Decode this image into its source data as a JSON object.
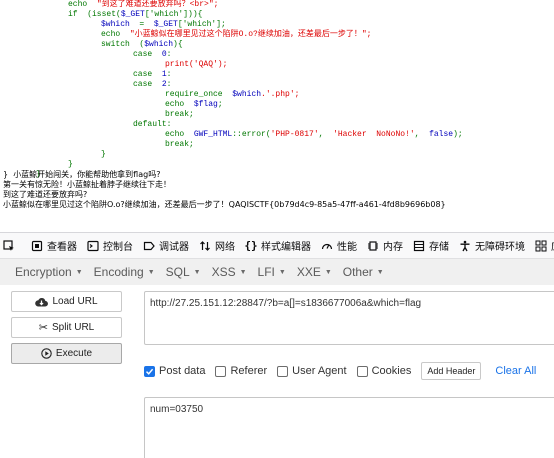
{
  "page_output": {
    "code_lines": [
      [
        {
          "t": "echo  ",
          "c": "kw"
        },
        {
          "t": "\"到这了难道还要放弃吗？<br>\";",
          "c": "str"
        }
      ],
      [
        {
          "t": "if  (isset(",
          "c": "kw"
        },
        {
          "t": "$_GET",
          "c": "var"
        },
        {
          "t": "['which'])){",
          "c": "kw"
        }
      ],
      [
        {
          "t": "$which  ",
          "c": "var"
        },
        {
          "t": "=  ",
          "c": "kw"
        },
        {
          "t": "$_GET",
          "c": "var"
        },
        {
          "t": "['which'];",
          "c": "kw"
        }
      ],
      [
        {
          "t": "echo  ",
          "c": "kw"
        },
        {
          "t": "\"小蓝鲸似在哪里见过这个陷阱O.o?继续加油，还差最后一步了！\";",
          "c": "str"
        }
      ],
      [
        {
          "t": "switch  (",
          "c": "kw"
        },
        {
          "t": "$which",
          "c": "var"
        },
        {
          "t": "){",
          "c": "kw"
        }
      ],
      [
        {
          "t": "case  ",
          "c": "kw"
        },
        {
          "t": "0",
          "c": "var"
        },
        {
          "t": ":",
          "c": "kw"
        }
      ],
      [
        {
          "t": "print('QAQ');",
          "c": "str"
        }
      ],
      [
        {
          "t": "case  ",
          "c": "kw"
        },
        {
          "t": "1",
          "c": "var"
        },
        {
          "t": ":",
          "c": "kw"
        }
      ],
      [
        {
          "t": "case  ",
          "c": "kw"
        },
        {
          "t": "2",
          "c": "var"
        },
        {
          "t": ":",
          "c": "kw"
        }
      ],
      [
        {
          "t": "require_once  ",
          "c": "kw"
        },
        {
          "t": "$which",
          "c": "var"
        },
        {
          "t": ".'.php';",
          "c": "str"
        }
      ],
      [
        {
          "t": "echo  ",
          "c": "kw"
        },
        {
          "t": "$flag",
          "c": "var"
        },
        {
          "t": ";",
          "c": "kw"
        }
      ],
      [
        {
          "t": "break;",
          "c": "kw"
        }
      ],
      [
        {
          "t": "default:",
          "c": "kw"
        }
      ],
      [
        {
          "t": "echo  ",
          "c": "kw"
        },
        {
          "t": "GWF_HTML",
          "c": "var"
        },
        {
          "t": "::error(",
          "c": "kw"
        },
        {
          "t": "'PHP-0817'",
          "c": "str"
        },
        {
          "t": ",  ",
          "c": "kw"
        },
        {
          "t": "'Hacker  NoNoNo!'",
          "c": "str"
        },
        {
          "t": ",  ",
          "c": "kw"
        },
        {
          "t": "false",
          "c": "var"
        },
        {
          "t": ");",
          "c": "kw"
        }
      ],
      [
        {
          "t": "break;",
          "c": "kw"
        }
      ],
      [
        {
          "t": "}",
          "c": "kw"
        }
      ],
      [
        {
          "t": "}",
          "c": "kw"
        }
      ],
      [
        {
          "t": "}",
          "c": "kw"
        }
      ]
    ],
    "output_line1_prefix": "}",
    "output_line1_text": "小蓝鲸开始闯关，你能帮助他拿到flag吗?",
    "output_line2": "第一关有惊无险！小蓝鲸扯着脖子继续往下走！",
    "output_line3": "到这了难道还要放弃吗?",
    "output_line4": "小蓝鲸似在哪里见过这个陷阱O.o?继续加油，还差最后一步了！QAQISCTF{0b79d4c9-85a5-47ff-a461-4fd8b9696b08}"
  },
  "devtools": {
    "tabs": [
      {
        "name": "inspector",
        "icon": "inspector-icon",
        "label": "查看器"
      },
      {
        "name": "console",
        "icon": "console-icon",
        "label": "控制台"
      },
      {
        "name": "debugger",
        "icon": "debugger-icon",
        "label": "调试器"
      },
      {
        "name": "network",
        "icon": "network-icon",
        "label": "网络"
      },
      {
        "name": "style-editor",
        "icon": "style-editor-icon",
        "label": "样式编辑器"
      },
      {
        "name": "performance",
        "icon": "performance-icon",
        "label": "性能"
      },
      {
        "name": "memory",
        "icon": "memory-icon",
        "label": "内存"
      },
      {
        "name": "storage",
        "icon": "storage-icon",
        "label": "存储"
      },
      {
        "name": "accessibility",
        "icon": "accessibility-icon",
        "label": "无障碍环境"
      },
      {
        "name": "application",
        "icon": "application-icon",
        "label": "应"
      }
    ]
  },
  "hackbar": {
    "menu": [
      {
        "label": "Encryption"
      },
      {
        "label": "Encoding"
      },
      {
        "label": "SQL"
      },
      {
        "label": "XSS"
      },
      {
        "label": "LFI"
      },
      {
        "label": "XXE"
      },
      {
        "label": "Other"
      }
    ],
    "load_url_label": "Load URL",
    "split_url_label": "Split URL",
    "execute_label": "Execute",
    "url_value": "http://27.25.151.12:28847/?b=a[]=s1836677006a&which=flag",
    "options": {
      "post_data_label": "Post data",
      "post_data_checked": true,
      "referer_label": "Referer",
      "user_agent_label": "User Agent",
      "cookies_label": "Cookies",
      "add_header_label": "Add Header",
      "clear_all_label": "Clear All"
    },
    "post_body_value": "num=03750"
  },
  "colors": {
    "accent": "#1a73e8",
    "code_keyword": "#007700",
    "code_variable": "#0000bb",
    "code_string": "#dd0000"
  }
}
